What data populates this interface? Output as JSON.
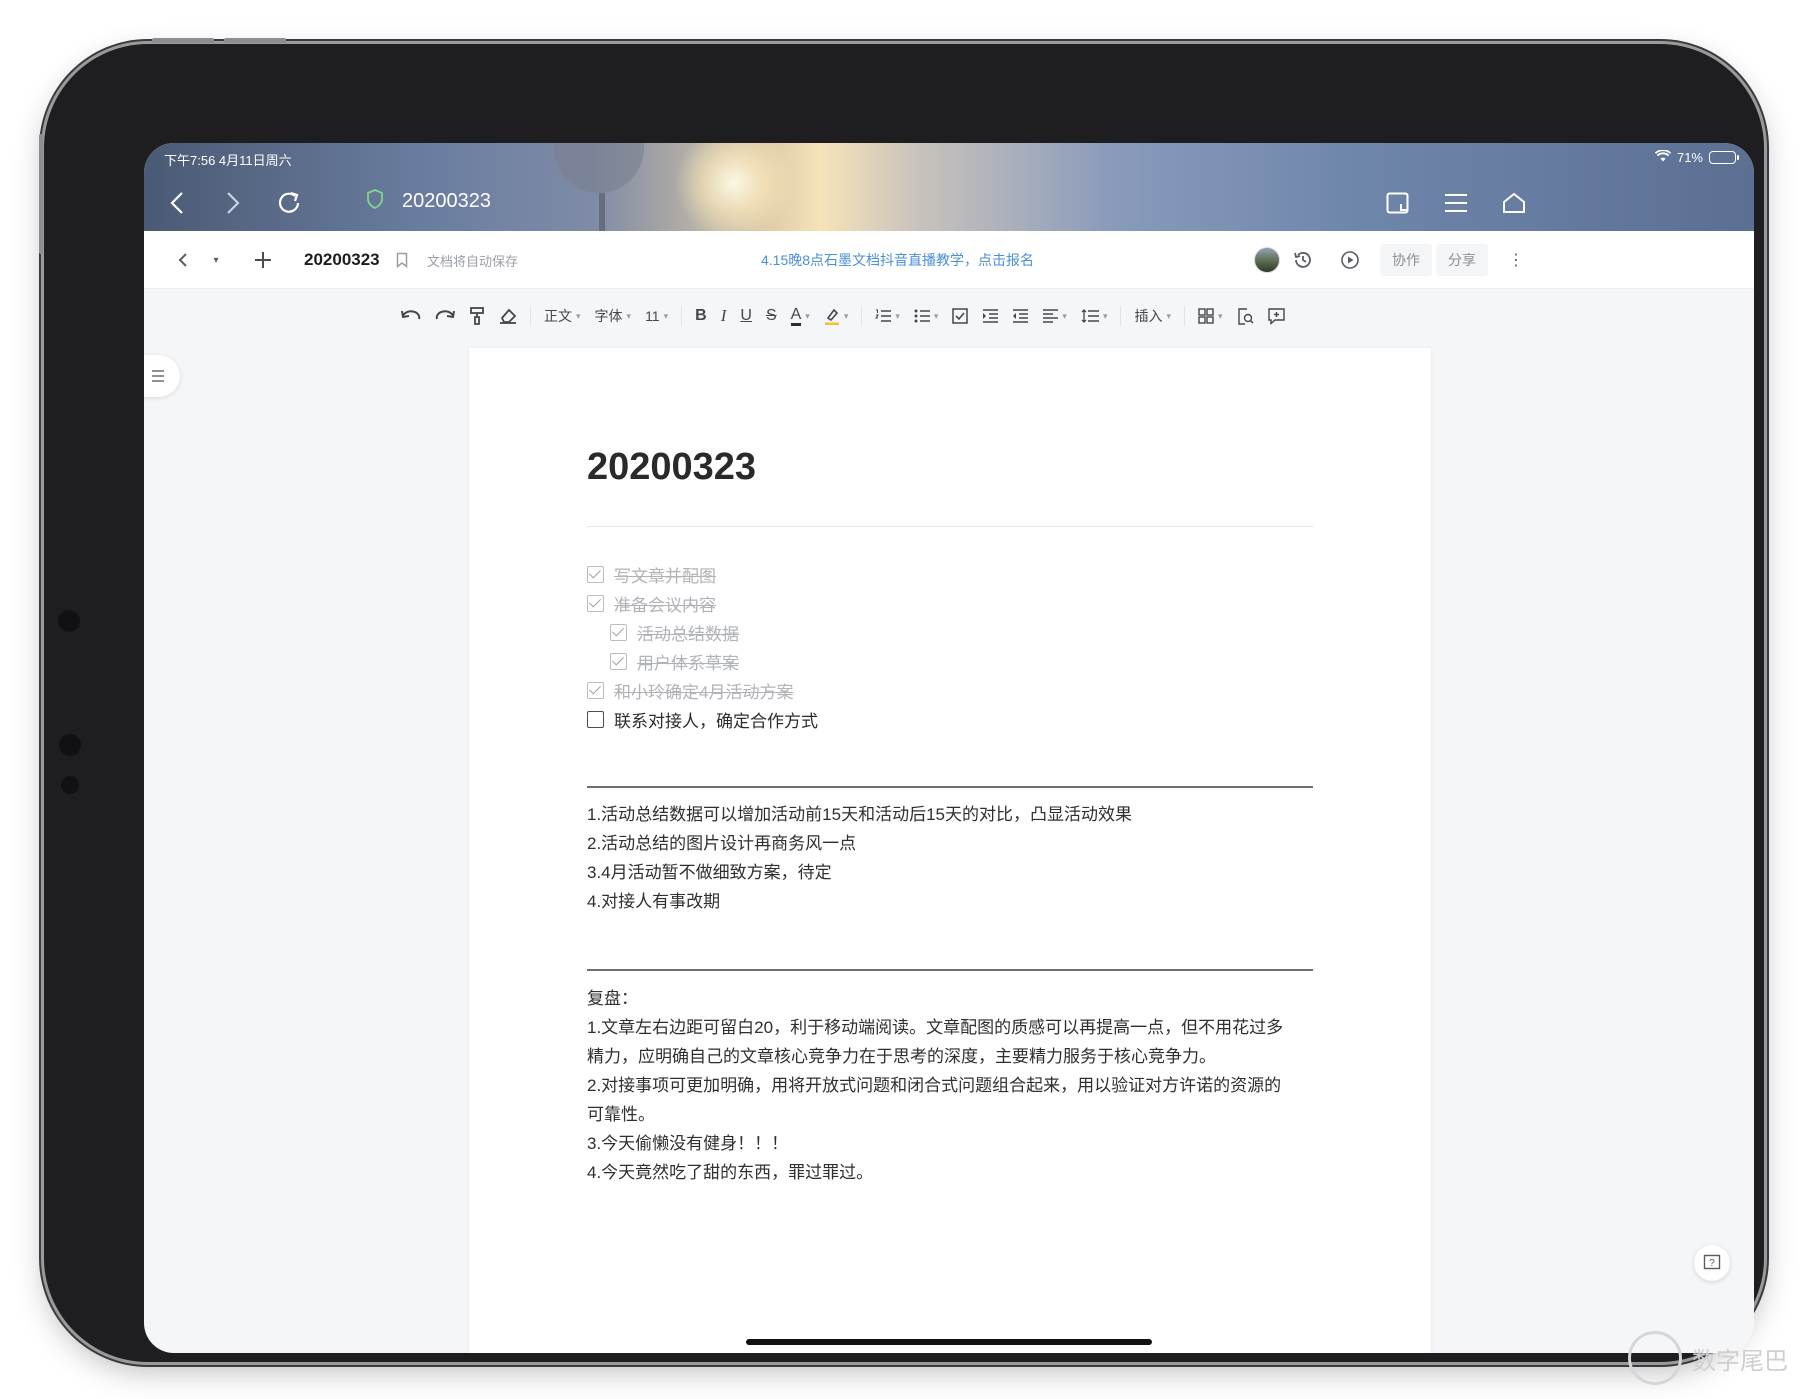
{
  "status": {
    "time_date": "下午7:56  4月11日周六",
    "battery": "71%"
  },
  "browser": {
    "url": "20200323"
  },
  "appbar": {
    "doc_name": "20200323",
    "autosave": "文档将自动保存",
    "announcement": "4.15晚8点石墨文档抖音直播教学，点击报名",
    "collab": "协作",
    "share": "分享"
  },
  "toolbar": {
    "style": "正文",
    "font": "字体",
    "size": "11",
    "bold": "B",
    "italic": "I",
    "underline": "U",
    "strike": "S",
    "font_color": "A",
    "insert": "插入"
  },
  "doc": {
    "title": "20200323",
    "todos": [
      {
        "text": "写文章并配图",
        "done": true
      },
      {
        "text": "准备会议内容",
        "done": true
      },
      {
        "text": "活动总结数据",
        "done": true
      },
      {
        "text": "用户体系草案",
        "done": true
      },
      {
        "text": "和小玲确定4月活动方案",
        "done": true
      },
      {
        "text": "联系对接人，确定合作方式",
        "done": false
      }
    ],
    "notes": [
      "1.活动总结数据可以增加活动前15天和活动后15天的对比，凸显活动效果",
      "2.活动总结的图片设计再商务风一点",
      "3.4月活动暂不做细致方案，待定",
      "4.对接人有事改期"
    ],
    "review_lines": [
      "复盘：",
      "1.文章左右边距可留白20，利于移动端阅读。文章配图的质感可以再提高一点，但不用花过多",
      "精力，应明确自己的文章核心竞争力在于思考的深度，主要精力服务于核心竞争力。",
      "2.对接事项可更加明确，用将开放式问题和闭合式问题组合起来，用以验证对方许诺的资源的",
      "可靠性。",
      "3.今天偷懒没有健身！！！",
      "4.今天竟然吃了甜的东西，罪过罪过。"
    ]
  },
  "watermark": "数字尾巴"
}
